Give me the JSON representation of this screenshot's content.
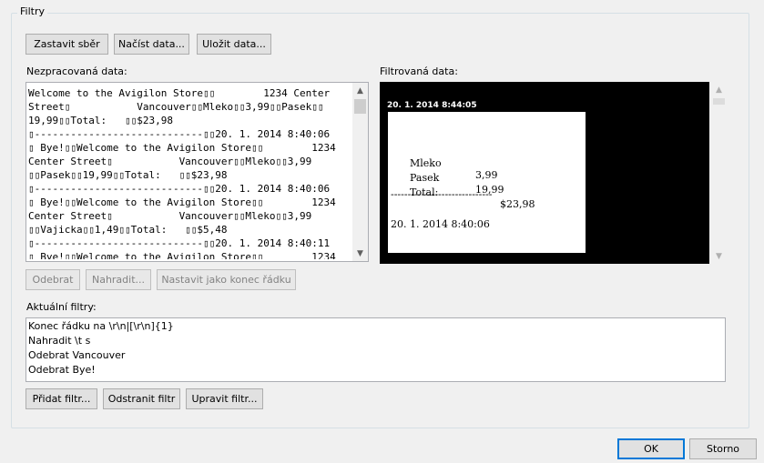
{
  "group": {
    "title": "Filtry"
  },
  "toolbar": {
    "stop": "Zastavit sběr",
    "load": "Načíst data...",
    "save": "Uložit data..."
  },
  "raw": {
    "label": "Nezpracovaná data:",
    "lines": [
      "Welcome to the Avigilon Store▯▯        1234 Center",
      "Street▯           Vancouver▯▯Mleko▯▯3,99▯▯Pasek▯▯",
      "19,99▯▯Total:   ▯▯$23,98",
      "▯----------------------------▯▯20. 1. 2014 8:40:06",
      "▯ Bye!▯▯Welcome to the Avigilon Store▯▯        1234",
      "Center Street▯           Vancouver▯▯Mleko▯▯3,99",
      "▯▯Pasek▯▯19,99▯▯Total:   ▯▯$23,98",
      "▯----------------------------▯▯20. 1. 2014 8:40:06",
      "▯ Bye!▯▯Welcome to the Avigilon Store▯▯        1234",
      "Center Street▯           Vancouver▯▯Mleko▯▯3,99",
      "▯▯Vajicka▯▯1,49▯▯Total:   ▯▯$5,48",
      "▯----------------------------▯▯20. 1. 2014 8:40:11",
      "▯ Bye!▯▯Welcome to the Avigilon Store▯▯        1234"
    ]
  },
  "filtered": {
    "label": "Filtrovaná data:",
    "timestamp": "20. 1. 2014 8:44:05",
    "items": [
      {
        "name": "Mleko",
        "value": "3,99"
      },
      {
        "name": "Pasek",
        "value": "19,99"
      }
    ],
    "total_label": "Total:",
    "total_value": "$23,98",
    "separator": "------------------------------",
    "footer_date": "20. 1. 2014 8:40:06"
  },
  "raw_actions": {
    "remove": "Odebrat",
    "replace": "Nahradit...",
    "set_eol": "Nastavit jako konec řádku"
  },
  "filters": {
    "label": "Aktuální filtry:",
    "items": [
      "Konec řádku na \\r\\n|[\\r\\n]{1}",
      "Nahradit \\t s",
      "Odebrat Vancouver",
      "Odebrat Bye!"
    ]
  },
  "filter_actions": {
    "add": "Přidat filtr...",
    "remove": "Odstranit filtr",
    "edit": "Upravit filtr..."
  },
  "dialog": {
    "ok": "OK",
    "cancel": "Storno"
  }
}
